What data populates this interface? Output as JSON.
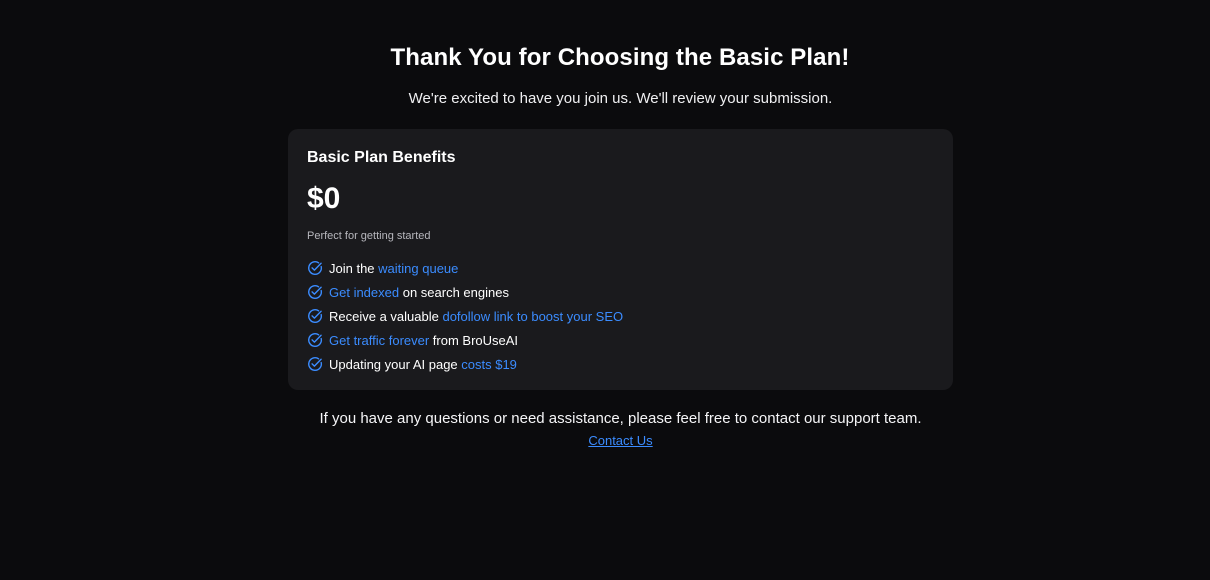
{
  "header": {
    "title": "Thank You for Choosing the Basic Plan!",
    "subtitle": "We're excited to have you join us. We'll review your submission."
  },
  "plan_card": {
    "title": "Basic Plan Benefits",
    "price": "$0",
    "tagline": "Perfect for getting started",
    "benefits": [
      {
        "before": "Join the ",
        "highlight": "waiting queue",
        "after": ""
      },
      {
        "before": "",
        "highlight": "Get indexed",
        "after": " on search engines"
      },
      {
        "before": "Receive a valuable ",
        "highlight": "dofollow link to boost your SEO",
        "after": ""
      },
      {
        "before": "",
        "highlight": "Get traffic forever",
        "after": " from BroUseAI"
      },
      {
        "before": "Updating your AI page ",
        "highlight": "costs $19",
        "after": ""
      }
    ],
    "icon": "check-circle-icon"
  },
  "footer": {
    "support_text": "If you have any questions or need assistance, please feel free to contact our support team.",
    "contact_label": "Contact Us"
  },
  "colors": {
    "background": "#0b0b0d",
    "card": "#1a1a1d",
    "accent": "#3b8cff",
    "text": "#ffffff"
  }
}
